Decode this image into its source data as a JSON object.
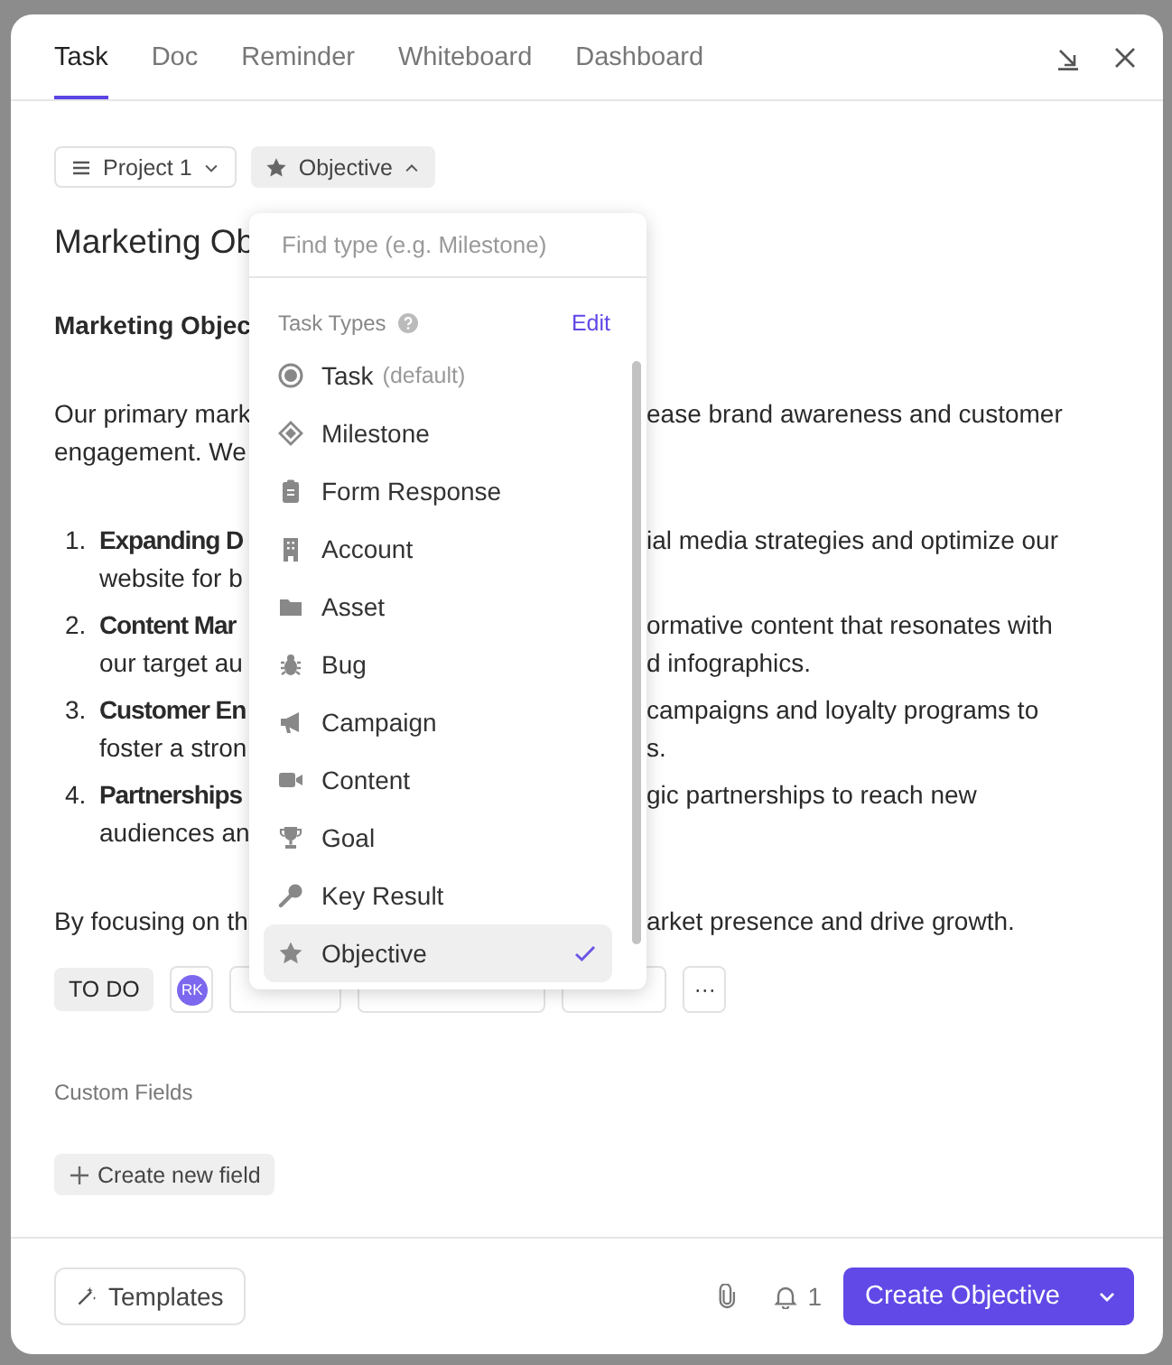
{
  "tabs": [
    {
      "label": "Task",
      "selected": true
    },
    {
      "label": "Doc",
      "selected": false
    },
    {
      "label": "Reminder",
      "selected": false
    },
    {
      "label": "Whiteboard",
      "selected": false
    },
    {
      "label": "Dashboard",
      "selected": false
    }
  ],
  "location_chip": "Project 1",
  "type_chip": {
    "label": "Objective",
    "expanded": true
  },
  "title": "Marketing Ob",
  "heading": "Marketing Objec",
  "body": [
    {
      "kind": "paragraph",
      "lines": [
        {
          "left": "Our primary mark",
          "right": "ease brand awareness and customer"
        },
        {
          "left": "engagement. We"
        }
      ]
    },
    {
      "kind": "list",
      "items": [
        {
          "number": "1.",
          "lines": [
            {
              "left": "Expanding D",
              "right": "ial media strategies and optimize our"
            },
            {
              "left": "website for b"
            }
          ]
        },
        {
          "number": "2.",
          "lines": [
            {
              "left": "Content Mar",
              "right": "ormative content that resonates with"
            },
            {
              "left": "our target au",
              "right": "d infographics."
            }
          ]
        },
        {
          "number": "3.",
          "lines": [
            {
              "left": "Customer En",
              "right": "campaigns and loyalty programs to"
            },
            {
              "left": "foster a stron",
              "right": "s."
            }
          ]
        },
        {
          "number": "4.",
          "lines": [
            {
              "left": "Partnerships",
              "right": "gic partnerships to reach new"
            },
            {
              "left": "audiences an"
            }
          ]
        }
      ]
    },
    {
      "kind": "paragraph",
      "lines": [
        {
          "left": "By focusing on th",
          "right": "arket presence and drive growth."
        }
      ]
    }
  ],
  "status": "TO DO",
  "assignee": "RK",
  "more": "···",
  "custom_fields_label": "Custom Fields",
  "create_field": "Create new field",
  "dropdown": {
    "placeholder": "Find type (e.g. Milestone)",
    "section": "Task Types",
    "edit": "Edit",
    "items": [
      {
        "kind": "task",
        "label": "Task",
        "note": "(default)",
        "selected": false
      },
      {
        "kind": "milestone",
        "label": "Milestone",
        "selected": false
      },
      {
        "kind": "form",
        "label": "Form Response",
        "selected": false
      },
      {
        "kind": "account",
        "label": "Account",
        "selected": false
      },
      {
        "kind": "asset",
        "label": "Asset",
        "selected": false
      },
      {
        "kind": "bug",
        "label": "Bug",
        "selected": false
      },
      {
        "kind": "campaign",
        "label": "Campaign",
        "selected": false
      },
      {
        "kind": "content",
        "label": "Content",
        "selected": false
      },
      {
        "kind": "goal",
        "label": "Goal",
        "selected": false
      },
      {
        "kind": "key",
        "label": "Key Result",
        "selected": false
      },
      {
        "kind": "objective",
        "label": "Objective",
        "selected": true
      }
    ]
  },
  "footer": {
    "templates": "Templates",
    "reminders": "1",
    "create": "Create Objective"
  }
}
